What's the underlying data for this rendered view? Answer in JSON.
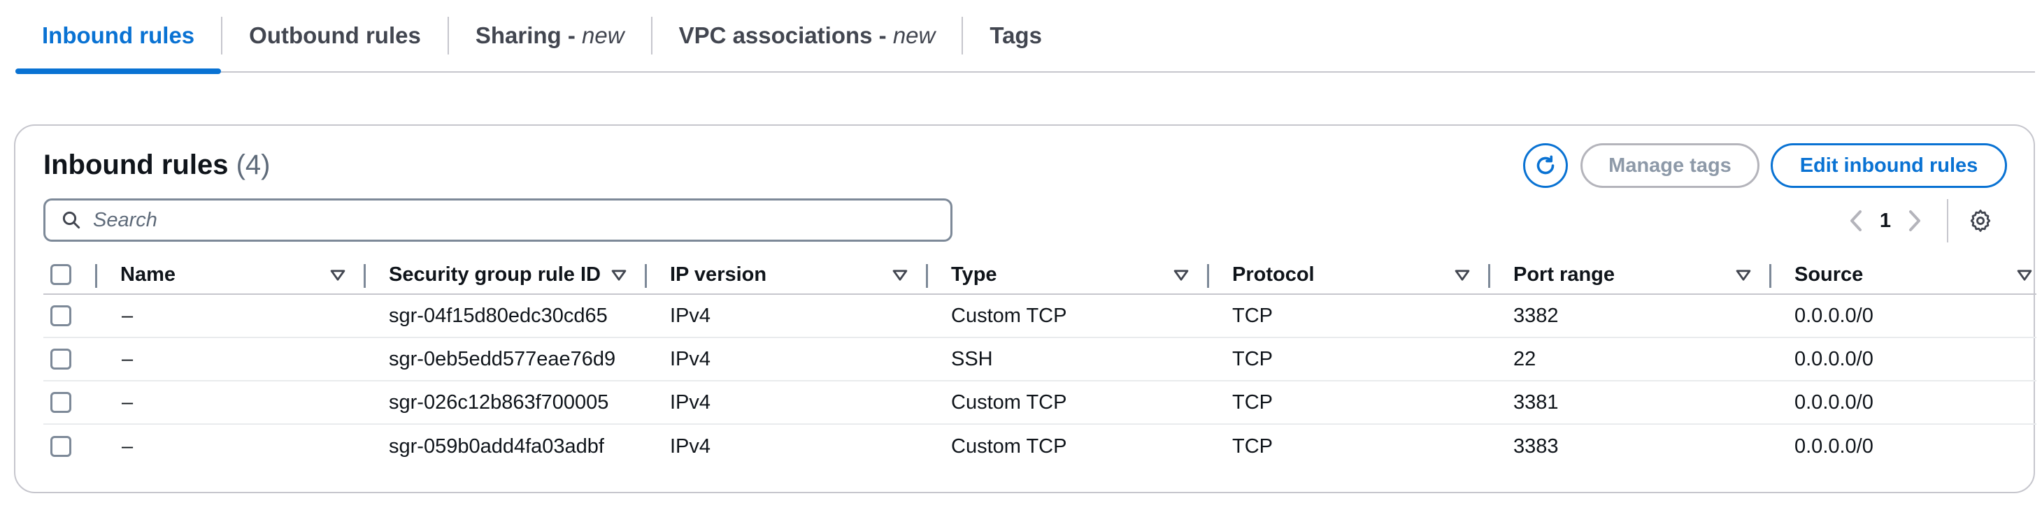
{
  "tabs": [
    {
      "label": "Inbound rules",
      "suffix": ""
    },
    {
      "label": "Outbound rules",
      "suffix": ""
    },
    {
      "label": "Sharing - ",
      "suffix": "new"
    },
    {
      "label": "VPC associations - ",
      "suffix": "new"
    },
    {
      "label": "Tags",
      "suffix": ""
    }
  ],
  "active_tab": "Inbound rules",
  "panel": {
    "title": "Inbound rules",
    "count": "(4)",
    "manage_tags_label": "Manage tags",
    "edit_label": "Edit inbound rules",
    "search_placeholder": "Search",
    "page": "1"
  },
  "table": {
    "columns": [
      "Name",
      "Security group rule ID",
      "IP version",
      "Type",
      "Protocol",
      "Port range",
      "Source"
    ],
    "rows": [
      [
        "–",
        "sgr-04f15d80edc30cd65",
        "IPv4",
        "Custom TCP",
        "TCP",
        "3382",
        "0.0.0.0/0"
      ],
      [
        "–",
        "sgr-0eb5edd577eae76d9",
        "IPv4",
        "SSH",
        "TCP",
        "22",
        "0.0.0.0/0"
      ],
      [
        "–",
        "sgr-026c12b863f700005",
        "IPv4",
        "Custom TCP",
        "TCP",
        "3381",
        "0.0.0.0/0"
      ],
      [
        "–",
        "sgr-059b0add4fa03adbf",
        "IPv4",
        "Custom TCP",
        "TCP",
        "3383",
        "0.0.0.0/0"
      ]
    ]
  },
  "colors": {
    "accent": "#0972d3",
    "disabled": "#8d99a8",
    "border": "#c6c6cd"
  },
  "icons": {
    "refresh": "refresh-icon",
    "search": "search-icon",
    "settings": "gear-icon",
    "sort": "caret-down-icon"
  }
}
